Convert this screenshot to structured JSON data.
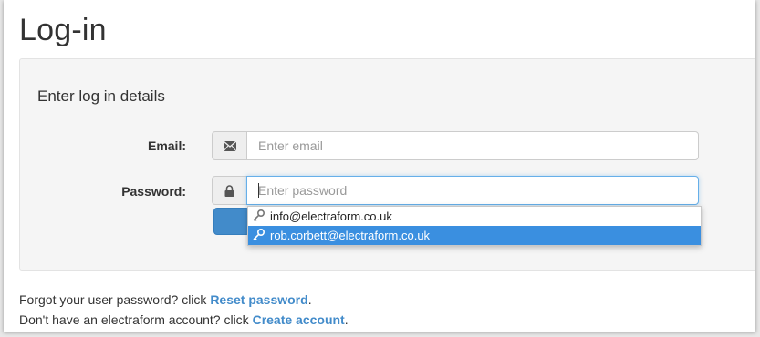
{
  "page": {
    "title": "Log-in"
  },
  "panel": {
    "heading": "Enter log in details",
    "email": {
      "label": "Email:",
      "placeholder": "Enter email",
      "value": ""
    },
    "password": {
      "label": "Password:",
      "placeholder": "Enter password",
      "value": ""
    }
  },
  "autocomplete": {
    "items": [
      {
        "text": "info@electraform.co.uk",
        "selected": false,
        "icon": "key-icon"
      },
      {
        "text": "rob.corbett@electraform.co.uk",
        "selected": true,
        "icon": "key-icon"
      }
    ]
  },
  "footer": {
    "reset_prefix": "Forgot your user password? click ",
    "reset_link": "Reset password",
    "reset_suffix": ".",
    "create_prefix": "Don't have an electraform account? click ",
    "create_link": "Create account",
    "create_suffix": "."
  },
  "colors": {
    "accent": "#428bca",
    "selected": "#3a8fe0"
  }
}
